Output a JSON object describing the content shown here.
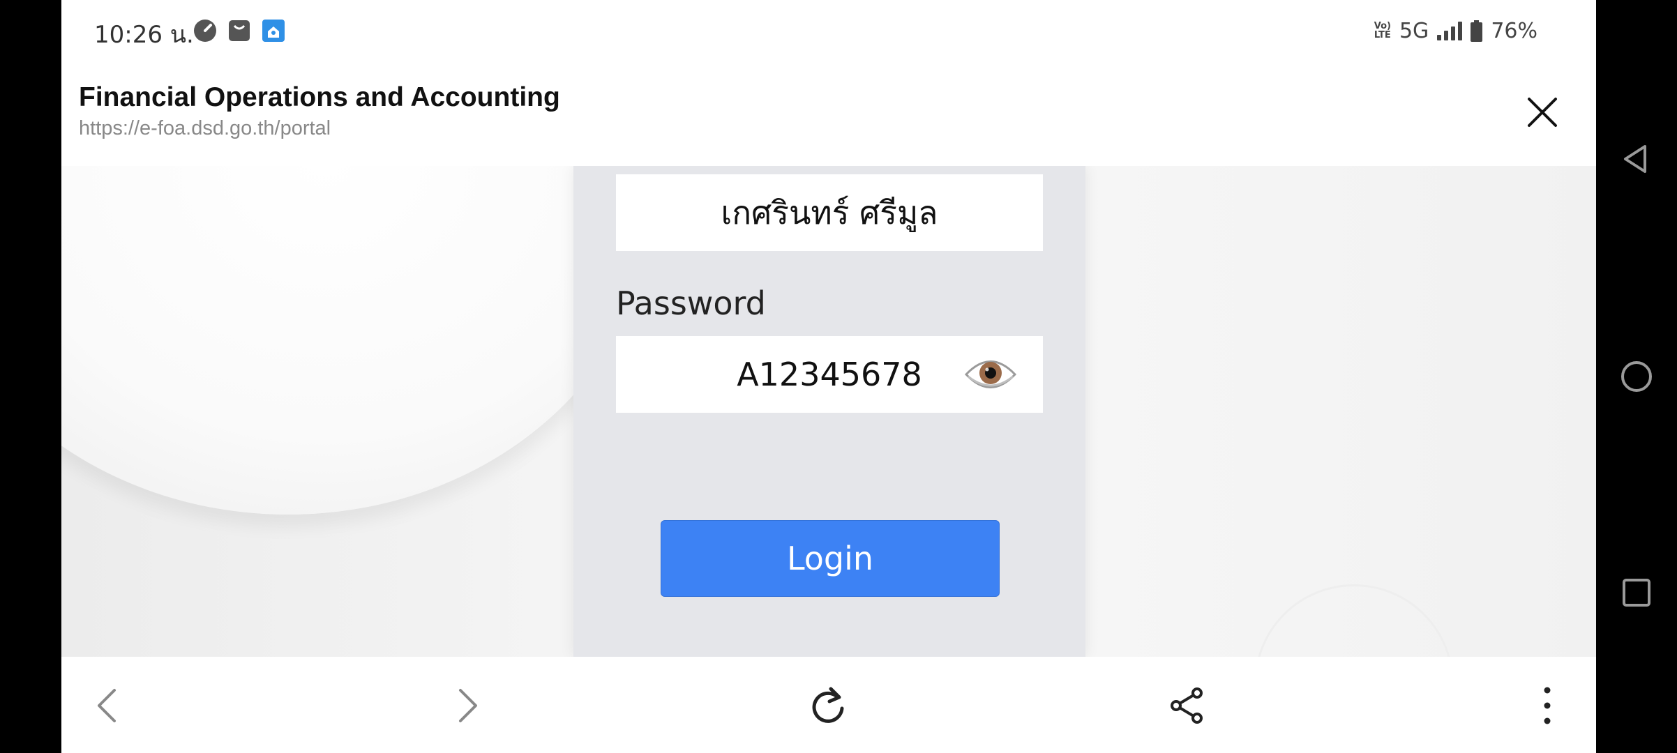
{
  "status_bar": {
    "time": "10:26 น.",
    "network_volte": "Vo) LTE",
    "network": "5G",
    "battery": "76%",
    "icons": [
      "speedometer-icon",
      "shopping-bag-icon",
      "house-app-icon",
      "volte-icon",
      "signal-icon",
      "battery-icon"
    ]
  },
  "tab": {
    "title": "Financial Operations and Accounting",
    "url": "https://e-foa.dsd.go.th/portal",
    "close_icon": "close-icon"
  },
  "login": {
    "username_value": "เกศรินทร์ ศรีมูล",
    "password_label": "Password",
    "password_value": "A12345678",
    "toggle_icon": "eye-icon",
    "login_button": "Login",
    "accent_color": "#3d82f4"
  },
  "toolbar": {
    "icons": [
      "back-icon",
      "forward-icon",
      "reload-icon",
      "share-icon",
      "more-icon"
    ]
  },
  "nav_bar": {
    "icons": [
      "nav-back-icon",
      "nav-home-icon",
      "nav-recents-icon"
    ]
  }
}
